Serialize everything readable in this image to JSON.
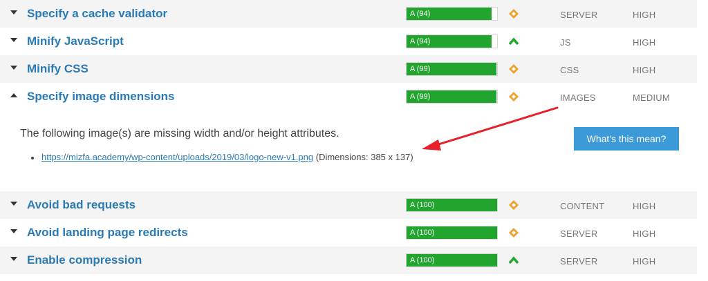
{
  "rules_top": [
    {
      "name": "Specify a cache validator",
      "grade": "A (94)",
      "score": 94,
      "priority": "diamond",
      "type": "SERVER",
      "impact": "HIGH",
      "expanded": false
    },
    {
      "name": "Minify JavaScript",
      "grade": "A (94)",
      "score": 94,
      "priority": "chevron-up",
      "type": "JS",
      "impact": "HIGH",
      "expanded": false
    },
    {
      "name": "Minify CSS",
      "grade": "A (99)",
      "score": 99,
      "priority": "diamond",
      "type": "CSS",
      "impact": "HIGH",
      "expanded": false
    },
    {
      "name": "Specify image dimensions",
      "grade": "A (99)",
      "score": 99,
      "priority": "diamond",
      "type": "IMAGES",
      "impact": "MEDIUM",
      "expanded": true
    }
  ],
  "detail": {
    "description": "The following image(s) are missing width and/or height attributes.",
    "items": [
      {
        "url": "https://mizfa.academy/wp-content/uploads/2019/03/logo-new-v1.png",
        "note": "(Dimensions: 385 x 137)"
      }
    ],
    "button_label": "What's this mean?"
  },
  "rules_bottom": [
    {
      "name": "Avoid bad requests",
      "grade": "A (100)",
      "score": 100,
      "priority": "diamond",
      "type": "CONTENT",
      "impact": "HIGH",
      "expanded": false
    },
    {
      "name": "Avoid landing page redirects",
      "grade": "A (100)",
      "score": 100,
      "priority": "diamond",
      "type": "SERVER",
      "impact": "HIGH",
      "expanded": false
    },
    {
      "name": "Enable compression",
      "grade": "A (100)",
      "score": 100,
      "priority": "chevron-up",
      "type": "SERVER",
      "impact": "HIGH",
      "expanded": false
    }
  ],
  "colors": {
    "grade_fill": "#21a52e",
    "diamond": "#f0a030",
    "chevron": "#21a52e",
    "link": "#2a7ab3",
    "button": "#3d9ad9",
    "arrow": "#e8202a"
  }
}
